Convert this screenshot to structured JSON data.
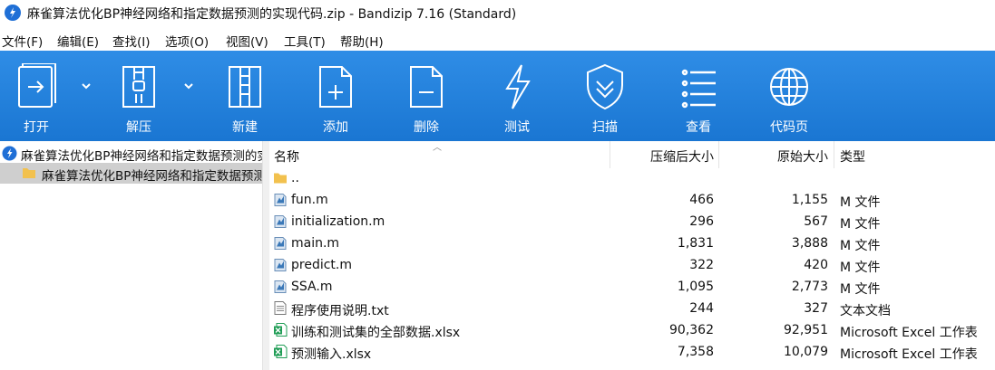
{
  "window": {
    "title": "麻雀算法优化BP神经网络和指定数据预测的实现代码.zip - Bandizip 7.16 (Standard)",
    "app_icon": "bandizip-logo-icon"
  },
  "menu": [
    "文件(F)",
    "编辑(E)",
    "查找(I)",
    "选项(O)",
    "视图(V)",
    "工具(T)",
    "帮助(H)"
  ],
  "toolbar": {
    "buttons": [
      {
        "label": "打开",
        "icon": "open-archive-icon"
      },
      {
        "label": "解压",
        "icon": "extract-icon"
      },
      {
        "label": "新建",
        "icon": "new-archive-icon"
      },
      {
        "label": "添加",
        "icon": "add-file-icon"
      },
      {
        "label": "删除",
        "icon": "delete-file-icon"
      },
      {
        "label": "测试",
        "icon": "test-lightning-icon"
      },
      {
        "label": "扫描",
        "icon": "scan-shield-icon"
      },
      {
        "label": "查看",
        "icon": "view-list-icon"
      },
      {
        "label": "代码页",
        "icon": "codepage-globe-icon"
      }
    ]
  },
  "tree": {
    "root": "麻雀算法优化BP神经网络和指定数据预测的实现代码.zip",
    "child": "麻雀算法优化BP神经网络和指定数据预测的实现代码"
  },
  "list": {
    "headers": {
      "name": "名称",
      "compressed": "压缩后大小",
      "original": "原始大小",
      "type": "类型"
    },
    "rows": [
      {
        "name": "..",
        "compressed": "",
        "original": "",
        "type": "",
        "icon": "folder-icon"
      },
      {
        "name": "fun.m",
        "compressed": "466",
        "original": "1,155",
        "type": "M 文件",
        "icon": "matlab-file-icon"
      },
      {
        "name": "initialization.m",
        "compressed": "296",
        "original": "567",
        "type": "M 文件",
        "icon": "matlab-file-icon"
      },
      {
        "name": "main.m",
        "compressed": "1,831",
        "original": "3,888",
        "type": "M 文件",
        "icon": "matlab-file-icon"
      },
      {
        "name": "predict.m",
        "compressed": "322",
        "original": "420",
        "type": "M 文件",
        "icon": "matlab-file-icon"
      },
      {
        "name": "SSA.m",
        "compressed": "1,095",
        "original": "2,773",
        "type": "M 文件",
        "icon": "matlab-file-icon"
      },
      {
        "name": "程序使用说明.txt",
        "compressed": "244",
        "original": "327",
        "type": "文本文档",
        "icon": "text-file-icon"
      },
      {
        "name": "训练和测试集的全部数据.xlsx",
        "compressed": "90,362",
        "original": "92,951",
        "type": "Microsoft Excel 工作表",
        "icon": "excel-file-icon"
      },
      {
        "name": "预测输入.xlsx",
        "compressed": "7,358",
        "original": "10,079",
        "type": "Microsoft Excel 工作表",
        "icon": "excel-file-icon"
      }
    ]
  },
  "colors": {
    "toolbar": "#1f7fdc",
    "selection": "#cfcfcf",
    "folder": "#f2c14e",
    "excel": "#1f9d55",
    "matlab": "#3a78b8"
  }
}
